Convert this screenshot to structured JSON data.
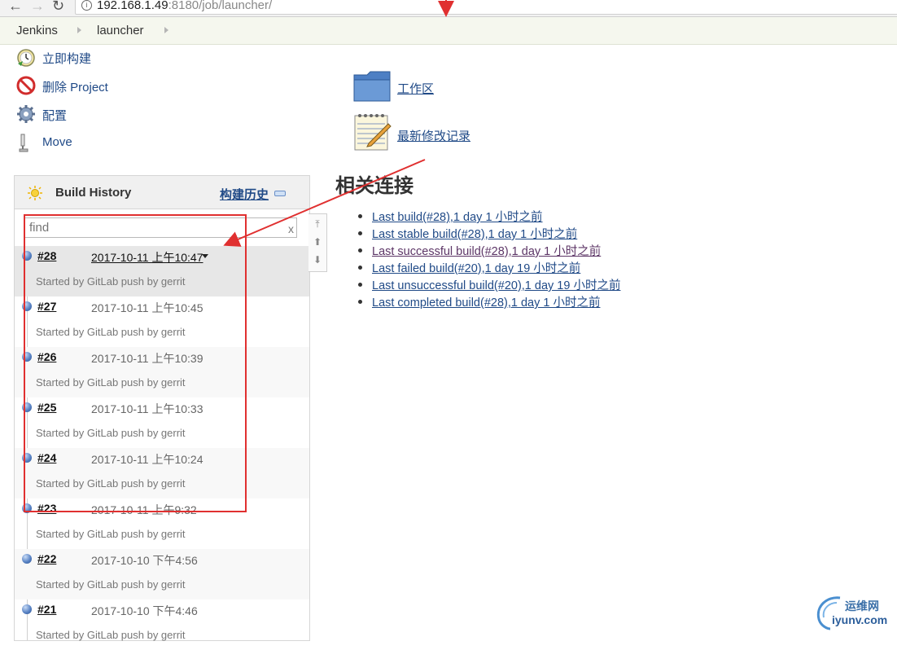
{
  "browser": {
    "url_host": "192.168.1.49",
    "url_path": ":8180/job/launcher/"
  },
  "breadcrumb": [
    "Jenkins",
    "launcher"
  ],
  "tasks": [
    {
      "label": "立即构建",
      "icon": "build-now-icon"
    },
    {
      "label": "删除 Project",
      "icon": "delete-icon"
    },
    {
      "label": "配置",
      "icon": "gear-icon"
    },
    {
      "label": "Move",
      "icon": "move-icon"
    }
  ],
  "build_history": {
    "title": "Build History",
    "trend_label": "构建历史",
    "find_placeholder": "find",
    "find_clear": "x",
    "builds": [
      {
        "number": "#28",
        "date": "2017-10-11 上午10:47",
        "desc": "Started by GitLab push by gerrit"
      },
      {
        "number": "#27",
        "date": "2017-10-11 上午10:45",
        "desc": "Started by GitLab push by gerrit"
      },
      {
        "number": "#26",
        "date": "2017-10-11 上午10:39",
        "desc": "Started by GitLab push by gerrit"
      },
      {
        "number": "#25",
        "date": "2017-10-11 上午10:33",
        "desc": "Started by GitLab push by gerrit"
      },
      {
        "number": "#24",
        "date": "2017-10-11 上午10:24",
        "desc": "Started by GitLab push by gerrit"
      },
      {
        "number": "#23",
        "date": "2017-10-11 上午9:32",
        "desc": "Started by GitLab push by gerrit"
      },
      {
        "number": "#22",
        "date": "2017-10-10 下午4:56",
        "desc": "Started by GitLab push by gerrit"
      },
      {
        "number": "#21",
        "date": "2017-10-10 下午4:46",
        "desc": "Started by GitLab push by gerrit"
      }
    ]
  },
  "main": {
    "workspace_label": "工作区",
    "changes_label": "最新修改记录",
    "related_title": "相关连接",
    "related_links": [
      "Last build(#28),1 day 1 小时之前",
      "Last stable build(#28),1 day 1 小时之前",
      "Last successful build(#28),1 day 1 小时之前",
      "Last failed build(#20),1 day 19 小时之前",
      "Last unsuccessful build(#20),1 day 19 小时之前",
      "Last completed build(#28),1 day 1 小时之前"
    ]
  },
  "watermark": {
    "top": "运维网",
    "bottom": "iyunv.com"
  },
  "colors": {
    "link": "#204a87",
    "annotation": "#e03030",
    "breadcrumb_bg": "#f5f7ee"
  }
}
